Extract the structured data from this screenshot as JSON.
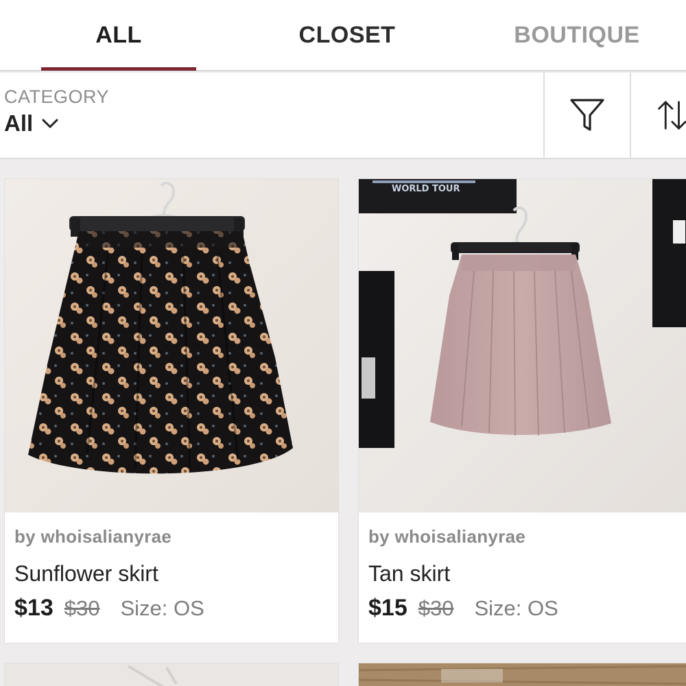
{
  "tabs": [
    {
      "label": "ALL",
      "active": true
    },
    {
      "label": "CLOSET",
      "active": false
    },
    {
      "label": "BOUTIQUE",
      "active": false
    }
  ],
  "filter": {
    "category_label": "CATEGORY",
    "category_value": "All",
    "icons": [
      "chevron-down-icon",
      "filter-funnel-icon",
      "sort-arrows-icon"
    ]
  },
  "listings": [
    {
      "seller": "by whoisalianyrae",
      "title": "Sunflower skirt",
      "price": "$13",
      "original_price": "$30",
      "size": "Size: OS"
    },
    {
      "seller": "by whoisalianyrae",
      "title": "Tan skirt",
      "price": "$15",
      "original_price": "$30",
      "size": "Size: OS"
    }
  ],
  "photo_text": {
    "poster_caption": "WORLD TOUR"
  },
  "colors": {
    "accent": "#7d2631",
    "skirt_black": "#151314",
    "skirt_tan": "#c4a6a3",
    "wall": "#eee8e2"
  }
}
